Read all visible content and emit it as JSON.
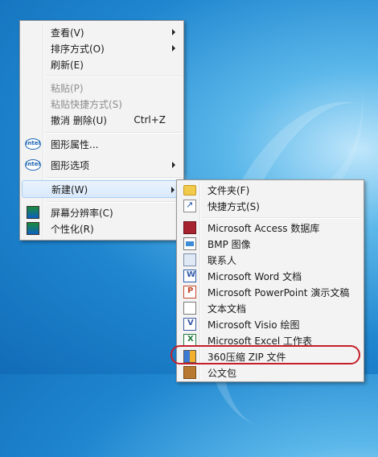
{
  "context_menu": {
    "items": [
      {
        "label": "查看(V)",
        "submenu": true
      },
      {
        "label": "排序方式(O)",
        "submenu": true
      },
      {
        "label": "刷新(E)"
      },
      {
        "label": "粘贴(P)",
        "disabled": true
      },
      {
        "label": "粘贴快捷方式(S)",
        "disabled": true
      },
      {
        "label": "撤消 删除(U)",
        "shortcut": "Ctrl+Z"
      },
      {
        "label": "图形属性...",
        "icon": "intel-icon",
        "icon_text": "intel"
      },
      {
        "label": "图形选项",
        "icon": "intel-icon",
        "icon_text": "intel",
        "submenu": true
      },
      {
        "label": "新建(W)",
        "submenu": true,
        "highlighted": true
      },
      {
        "label": "屏幕分辨率(C)",
        "icon": "display-icon"
      },
      {
        "label": "个性化(R)",
        "icon": "personalize-icon"
      }
    ]
  },
  "new_submenu": {
    "items": [
      {
        "label": "文件夹(F)",
        "icon": "folder-icon"
      },
      {
        "label": "快捷方式(S)",
        "icon": "shortcut-icon"
      },
      {
        "label": "Microsoft Access 数据库",
        "icon": "access-icon"
      },
      {
        "label": "BMP 图像",
        "icon": "bmp-image-icon"
      },
      {
        "label": "联系人",
        "icon": "contact-icon"
      },
      {
        "label": "Microsoft Word 文档",
        "icon": "word-icon"
      },
      {
        "label": "Microsoft PowerPoint 演示文稿",
        "icon": "powerpoint-icon"
      },
      {
        "label": "文本文档",
        "icon": "text-document-icon"
      },
      {
        "label": "Microsoft Visio 绘图",
        "icon": "visio-icon"
      },
      {
        "label": "Microsoft Excel 工作表",
        "icon": "excel-icon"
      },
      {
        "label": "360压缩 ZIP 文件",
        "icon": "zip-archive-icon",
        "circled": true
      },
      {
        "label": "公文包",
        "icon": "briefcase-icon"
      }
    ]
  },
  "colors": {
    "highlight_ring": "#c41e2a",
    "hover_bg": "#d9e9fb",
    "menu_bg": "#f3f3f3",
    "disabled_text": "#8d8d8d"
  }
}
